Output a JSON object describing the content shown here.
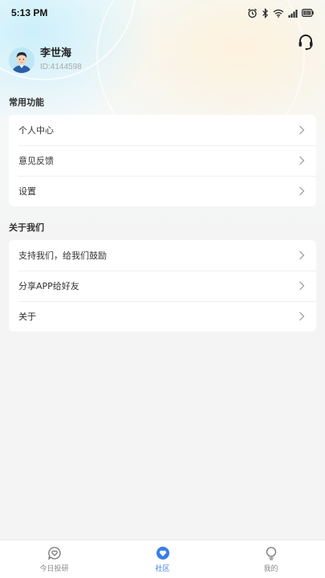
{
  "status_bar": {
    "time": "5:13 PM",
    "icons": [
      "alarm-icon",
      "bluetooth-icon",
      "wifi-icon",
      "signal-icon",
      "battery-icon"
    ]
  },
  "header": {
    "support_icon": "headset-icon"
  },
  "profile": {
    "name": "李世海",
    "id": "ID:4144598"
  },
  "sections": [
    {
      "title": "常用功能",
      "items": [
        {
          "label": "个人中心"
        },
        {
          "label": "意见反馈"
        },
        {
          "label": "设置"
        }
      ]
    },
    {
      "title": "关于我们",
      "items": [
        {
          "label": "支持我们，给我们鼓励"
        },
        {
          "label": "分享APP给好友"
        },
        {
          "label": "关于"
        }
      ]
    }
  ],
  "tabbar": {
    "tabs": [
      {
        "label": "今日投研",
        "icon": "heart-chat-icon",
        "active": false
      },
      {
        "label": "社区",
        "icon": "heart-bubble-icon",
        "active": true
      },
      {
        "label": "我的",
        "icon": "lightbulb-icon",
        "active": false
      }
    ]
  },
  "colors": {
    "accent": "#3a7ee8",
    "background": "#f4f4f4",
    "card": "#ffffff"
  }
}
